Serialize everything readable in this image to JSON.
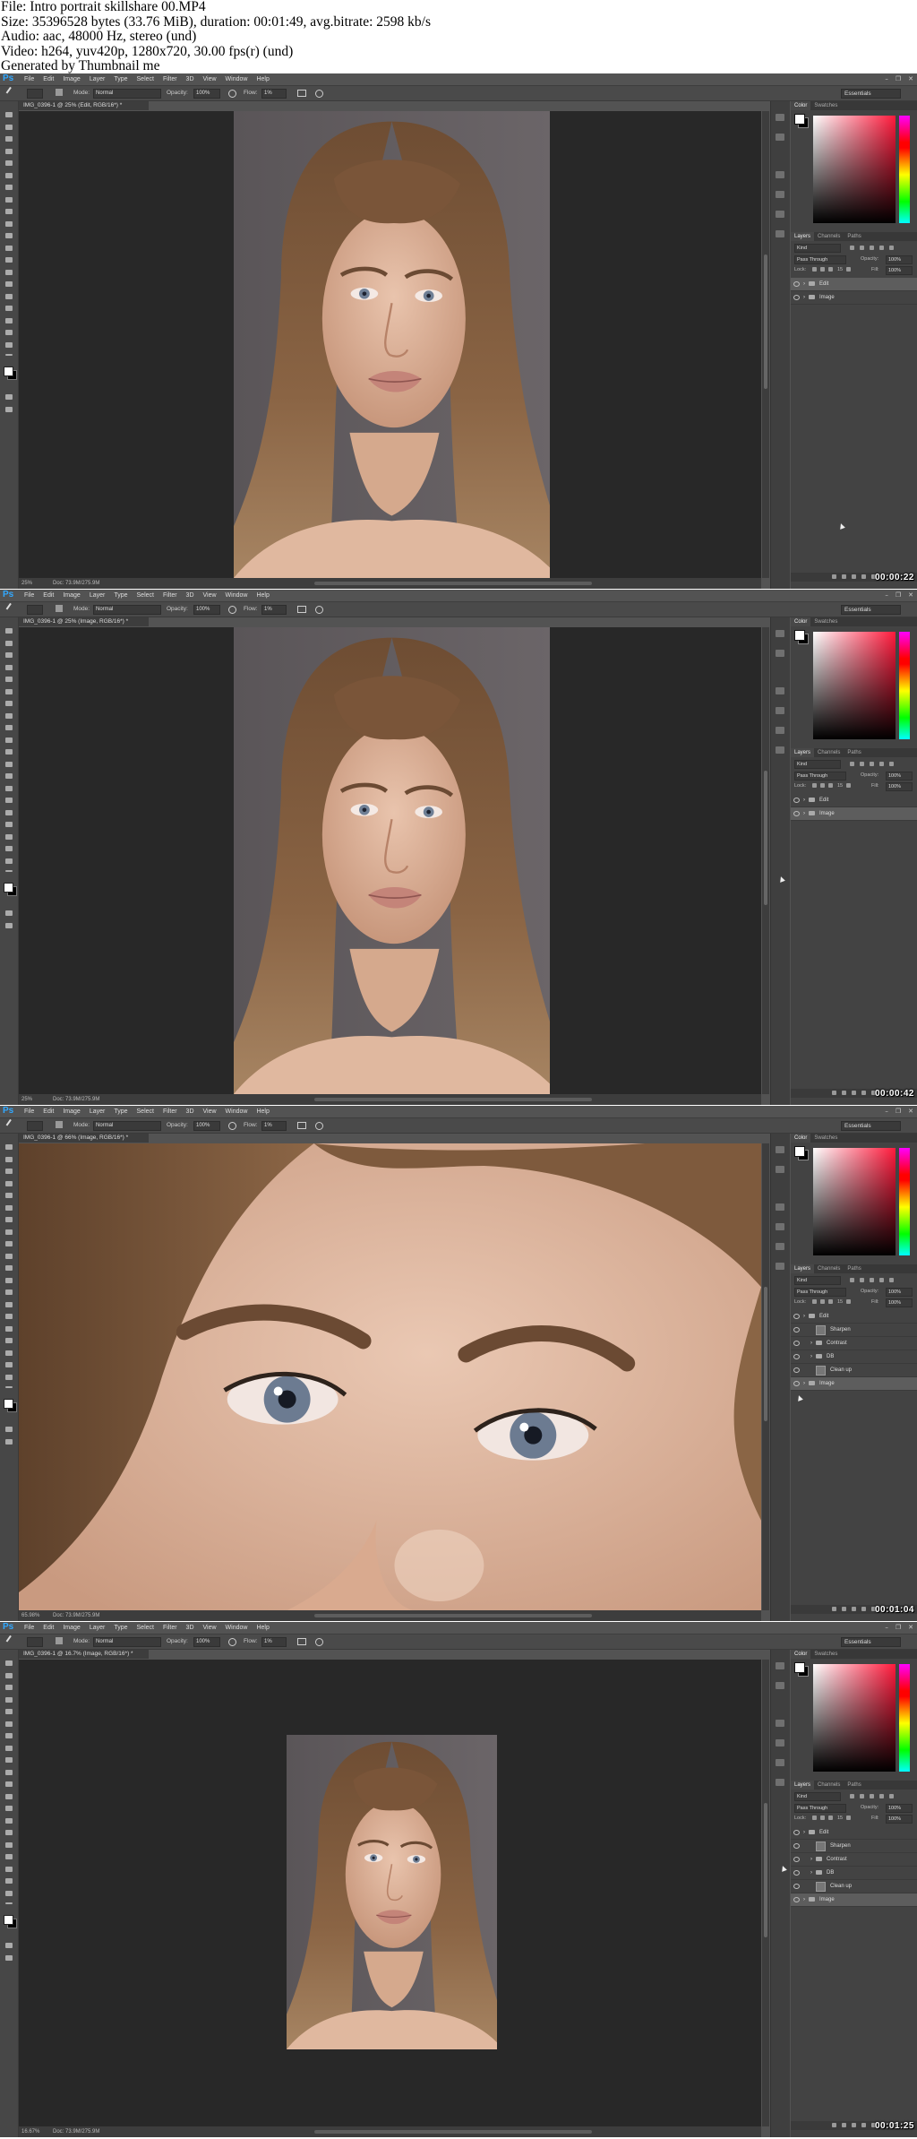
{
  "header": {
    "lines": [
      "File: Intro portrait skillshare 00.MP4",
      "Size: 35396528 bytes (33.76 MiB), duration: 00:01:49, avg.bitrate: 2598 kb/s",
      "Audio: aac, 48000 Hz, stereo (und)",
      "Video: h264, yuv420p, 1280x720, 30.00 fps(r) (und)",
      "Generated by Thumbnail me"
    ]
  },
  "app": {
    "logo": "Ps",
    "menu": [
      "File",
      "Edit",
      "Image",
      "Layer",
      "Type",
      "Select",
      "Filter",
      "3D",
      "View",
      "Window",
      "Help"
    ],
    "window_controls": [
      "–",
      "❐",
      "✕"
    ],
    "options": {
      "mode_label": "Mode:",
      "mode_value": "Normal",
      "opacity_label": "Opacity:",
      "opacity_value": "100%",
      "flow_label": "Flow:",
      "flow_value": "1%",
      "workspace": "Essentials"
    },
    "panels": {
      "color_tabs": [
        "Color",
        "Swatches"
      ],
      "layers_tabs": [
        "Layers",
        "Channels",
        "Paths"
      ],
      "kind_label": "Kind",
      "blend_mode": "Pass Through",
      "opacity_label": "Opacity:",
      "opacity_value": "100%",
      "lock_label": "Lock:",
      "fill_label": "Fill:",
      "fill_value": "100%",
      "lock_value": "15"
    }
  },
  "frames": [
    {
      "doc_tab": "IMG_0396-1 @ 25% (Edit, RGB/16*) *",
      "zoom": "25%",
      "doc_info": "Doc: 73.9M/275.9M",
      "timecode": "00:00:22",
      "view": "portrait",
      "layers": [
        {
          "name": "Edit",
          "type": "folder",
          "selected": true,
          "indent": 0
        },
        {
          "name": "Image",
          "type": "folder",
          "selected": false,
          "indent": 0
        }
      ]
    },
    {
      "doc_tab": "IMG_0396-1 @ 25% (Image, RGB/16*) *",
      "zoom": "25%",
      "doc_info": "Doc: 73.9M/275.9M",
      "timecode": "00:00:42",
      "view": "portrait",
      "layers": [
        {
          "name": "Edit",
          "type": "folder",
          "selected": false,
          "indent": 0
        },
        {
          "name": "Image",
          "type": "folder",
          "selected": true,
          "indent": 0
        }
      ]
    },
    {
      "doc_tab": "IMG_0396-1 @ 66% (Image, RGB/16*) *",
      "zoom": "65.98%",
      "doc_info": "Doc: 73.9M/275.9M",
      "timecode": "00:01:04",
      "view": "closeup",
      "layers": [
        {
          "name": "Edit",
          "type": "folder",
          "selected": false,
          "indent": 0
        },
        {
          "name": "Sharpen",
          "type": "layer",
          "selected": false,
          "indent": 1
        },
        {
          "name": "Contrast",
          "type": "folder",
          "selected": false,
          "indent": 1
        },
        {
          "name": "DB",
          "type": "folder",
          "selected": false,
          "indent": 1
        },
        {
          "name": "Clean up",
          "type": "layer",
          "selected": false,
          "indent": 1
        },
        {
          "name": "Image",
          "type": "folder",
          "selected": true,
          "indent": 0
        }
      ]
    },
    {
      "doc_tab": "IMG_0396-1 @ 16.7% (Image, RGB/16*) *",
      "zoom": "16.67%",
      "doc_info": "Doc: 73.9M/275.9M",
      "timecode": "00:01:25",
      "view": "small",
      "layers": [
        {
          "name": "Edit",
          "type": "folder",
          "selected": false,
          "indent": 0
        },
        {
          "name": "Sharpen",
          "type": "layer",
          "selected": false,
          "indent": 1
        },
        {
          "name": "Contrast",
          "type": "folder",
          "selected": false,
          "indent": 1
        },
        {
          "name": "DB",
          "type": "folder",
          "selected": false,
          "indent": 1
        },
        {
          "name": "Clean up",
          "type": "layer",
          "selected": false,
          "indent": 1
        },
        {
          "name": "Image",
          "type": "folder",
          "selected": true,
          "indent": 0
        }
      ]
    }
  ]
}
